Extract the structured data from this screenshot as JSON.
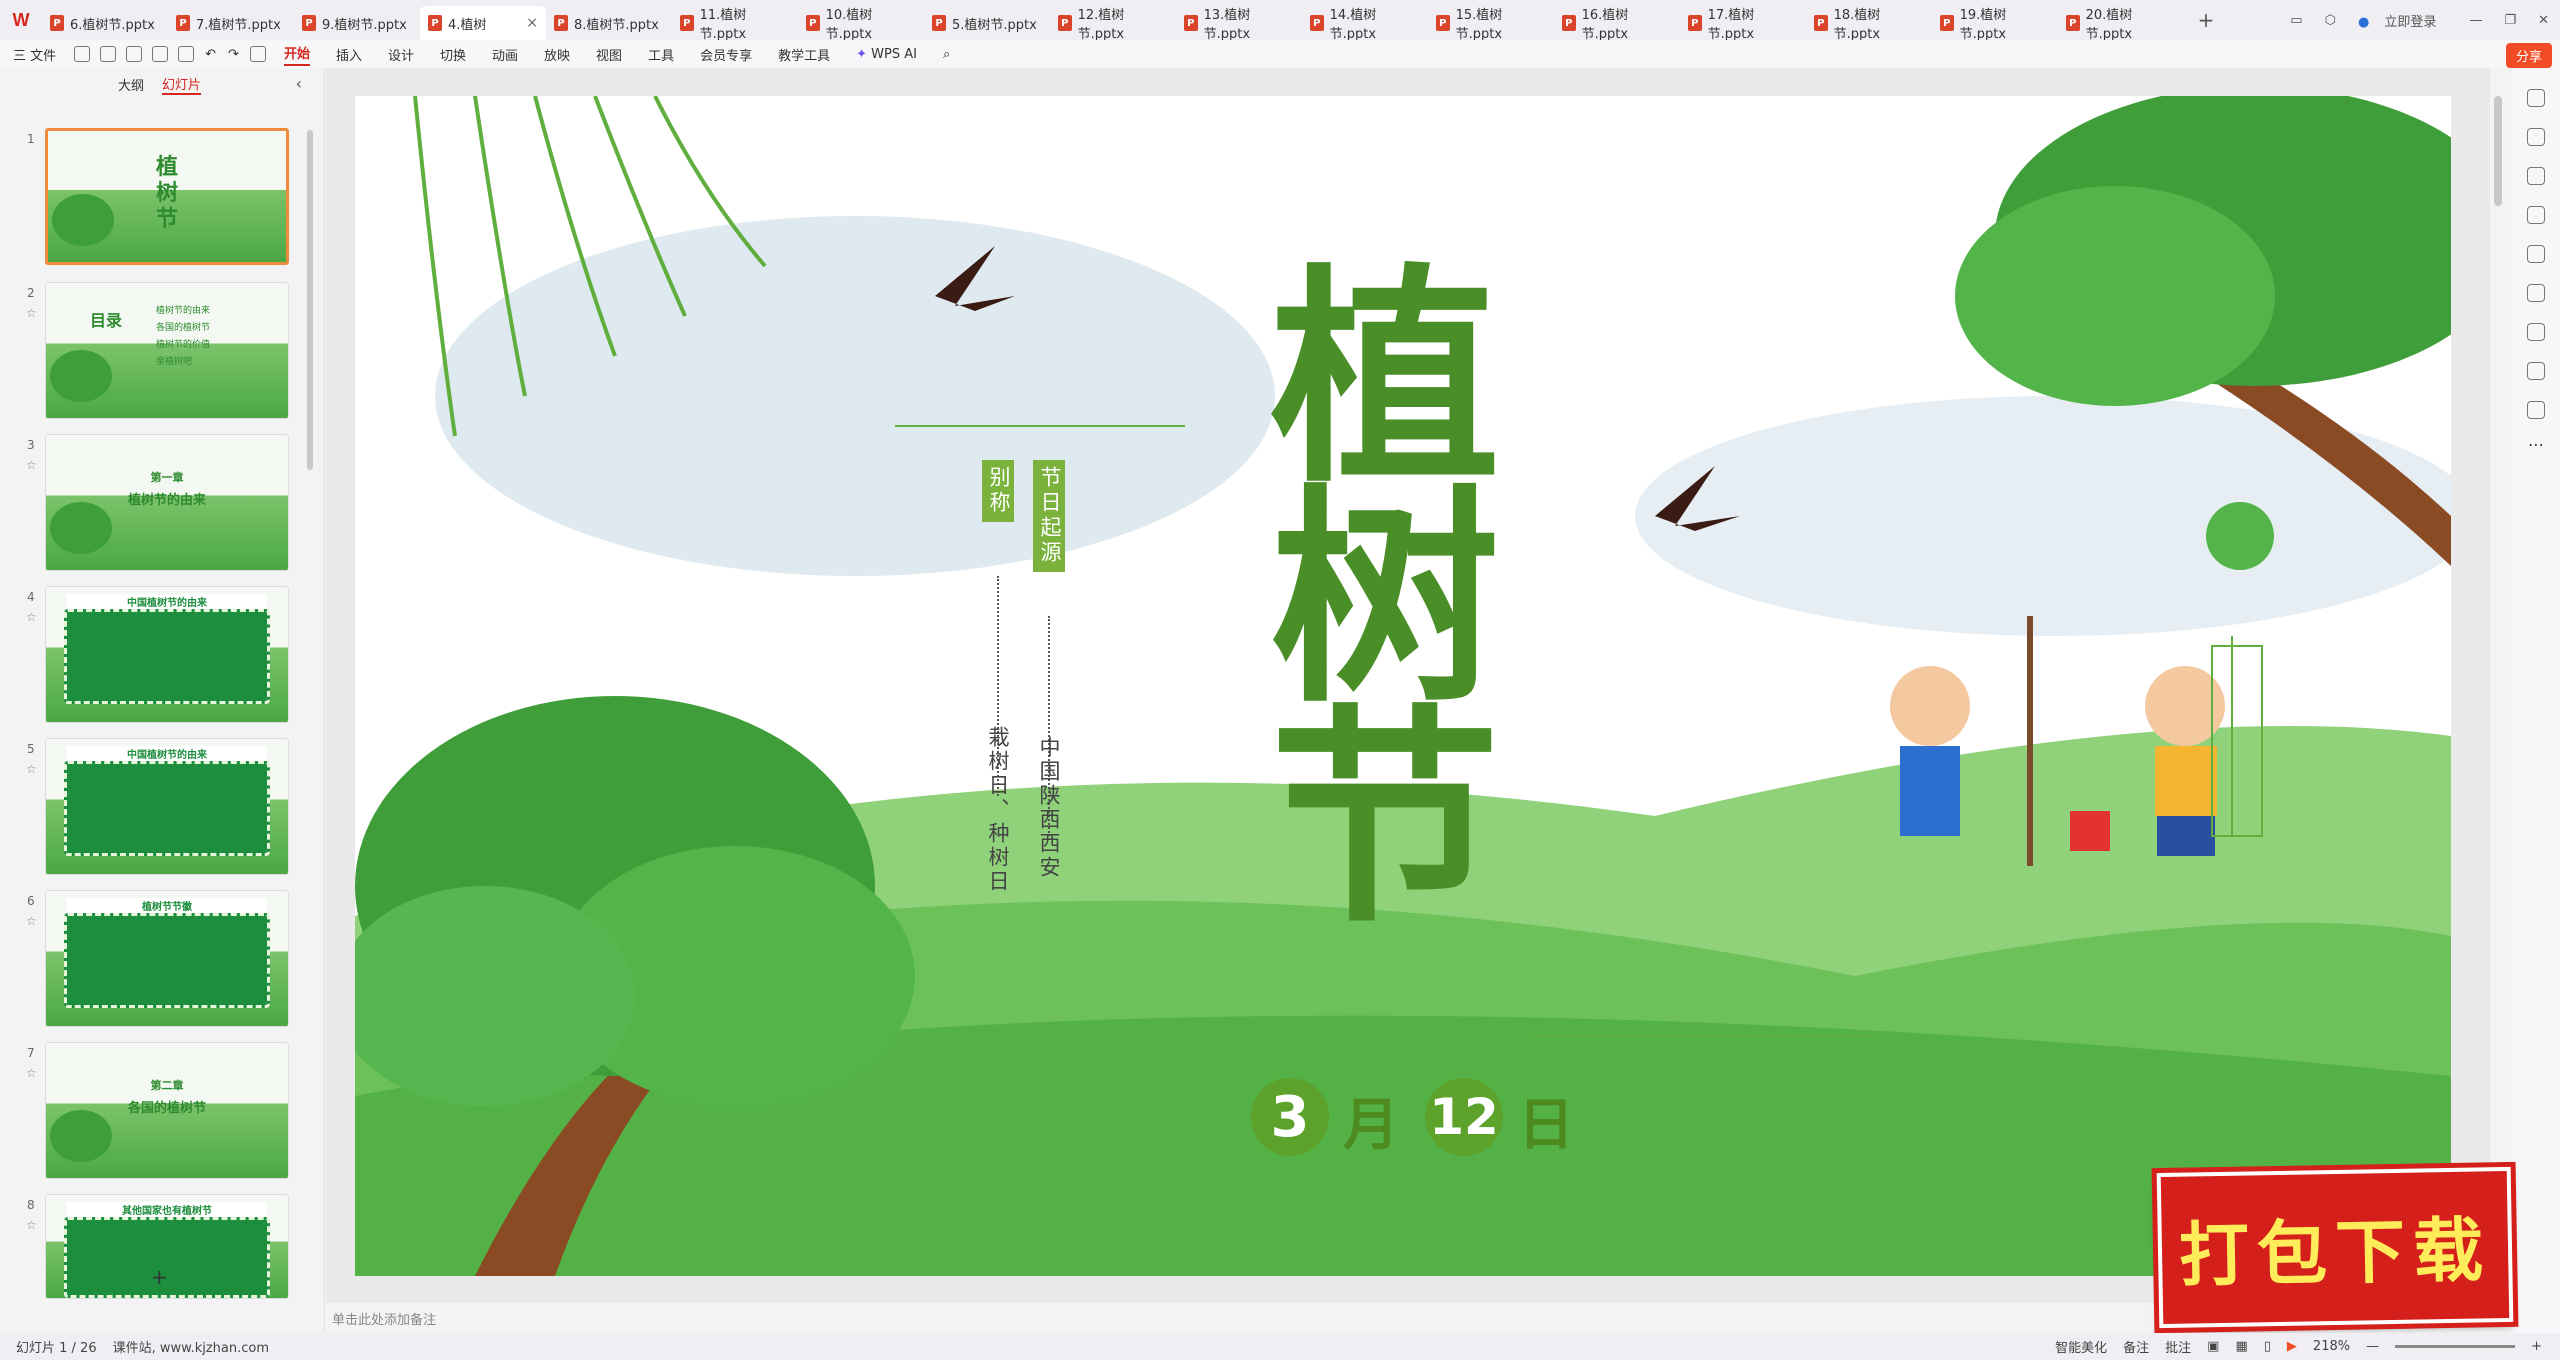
{
  "app": {
    "logo": "W"
  },
  "tabs": [
    {
      "label": "6.植树节.pptx"
    },
    {
      "label": "7.植树节.pptx"
    },
    {
      "label": "9.植树节.pptx"
    },
    {
      "label": "4.植树"
    },
    {
      "label": "8.植树节.pptx"
    },
    {
      "label": "11.植树节.pptx"
    },
    {
      "label": "10.植树节.pptx"
    },
    {
      "label": "5.植树节.pptx"
    },
    {
      "label": "12.植树节.pptx"
    },
    {
      "label": "13.植树节.pptx"
    },
    {
      "label": "14.植树节.pptx"
    },
    {
      "label": "15.植树节.pptx"
    },
    {
      "label": "16.植树节.pptx"
    },
    {
      "label": "17.植树节.pptx"
    },
    {
      "label": "18.植树节.pptx"
    },
    {
      "label": "19.植树节.pptx"
    },
    {
      "label": "20.植树节.pptx"
    }
  ],
  "window": {
    "login": "立即登录",
    "share": "分享"
  },
  "toolbar": {
    "file": "三 文件",
    "menus": [
      "开始",
      "插入",
      "设计",
      "切换",
      "动画",
      "放映",
      "视图",
      "工具",
      "会员专享",
      "教学工具"
    ],
    "wps_ai": "WPS AI"
  },
  "left_panel": {
    "outline_tab": "大纲",
    "slides_tab": "幻灯片",
    "add_button": "+"
  },
  "thumbnails": [
    {
      "num": "1",
      "title": "植树节"
    },
    {
      "num": "2",
      "title": "目录",
      "items": [
        "植树节的由来",
        "各国的植树节",
        "植树节的价值",
        "亲植树吧"
      ]
    },
    {
      "num": "3",
      "title": "第一章",
      "subtitle": "植树节的由来"
    },
    {
      "num": "4",
      "title": "中国植树节的由来"
    },
    {
      "num": "5",
      "title": "中国植树节的由来"
    },
    {
      "num": "6",
      "title": "植树节节徽"
    },
    {
      "num": "7",
      "title": "第二章",
      "subtitle": "各国的植树节"
    },
    {
      "num": "8",
      "title": "其他国家也有植树节"
    }
  ],
  "slide": {
    "title_chars": [
      "植",
      "树",
      "节"
    ],
    "alias_label": "别称",
    "origin_label": "节日起源",
    "alias_text": "栽树日、种树日",
    "origin_text": "中国陕西西安",
    "date": {
      "month_num": "3",
      "month": "月",
      "day_num": "12",
      "day": "日"
    }
  },
  "notes": {
    "placeholder": "单击此处添加备注"
  },
  "status": {
    "slide_count": "幻灯片 1 / 26",
    "source": "课件站, www.kjzhan.com",
    "smart": "智能美化",
    "notes": "备注",
    "comment": "批注",
    "zoom": "218%"
  },
  "watermark": {
    "label": "打包下载"
  },
  "colors": {
    "accent": "#d7261e",
    "slide_green": "#5da22a",
    "grass": "#6dc15a",
    "ppt_icon": "#d9442b"
  }
}
